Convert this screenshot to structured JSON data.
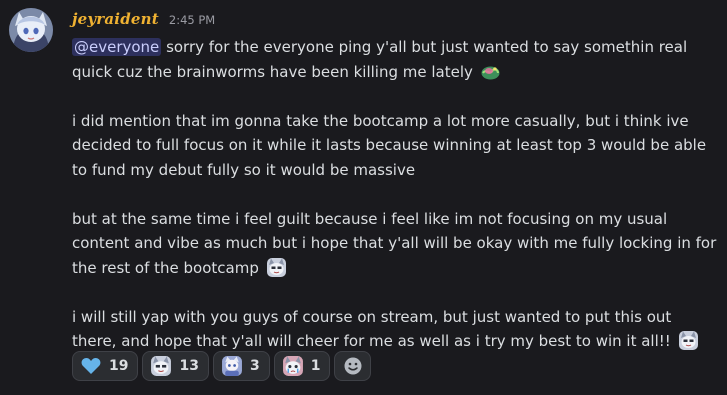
{
  "message": {
    "username": "jeyraident",
    "timestamp": "2:45 PM",
    "mention": "@everyone",
    "paragraphs": [
      " sorry for the everyone ping y'all but just wanted to say somethin real quick cuz the brainworms have been killing me lately",
      "i did mention that im gonna take the bootcamp a lot more casually, but i think ive decided to full focus on it while it lasts because winning at least top 3 would be able to fund my debut fully so it would be massive",
      "but at the same time i feel guilt because i feel like im not focusing on my usual content and vibe as much but i hope that y'all will be okay with me fully locking in for the rest of the bootcamp",
      "i will still yap with you guys of course on stream, but just wanted to put this out there, and hope that y'all will cheer for me as well as i try my best to win it all!!"
    ],
    "inline_emoji": [
      "brainworm-emoji",
      "cat-emote-emoji",
      "cat-emote-emoji"
    ]
  },
  "reactions": [
    {
      "emoji": "blue-heart-icon",
      "count": "19"
    },
    {
      "emoji": "cat-emote-icon",
      "count": "13"
    },
    {
      "emoji": "chibi-emote-icon",
      "count": "3"
    },
    {
      "emoji": "cat-crying-emote-icon",
      "count": "1"
    }
  ],
  "colors": {
    "background": "#1a1a1e",
    "username": "#f0b232",
    "text": "#dbdee1",
    "timestamp": "#9a9ba3",
    "mention_bg": "#3c4270",
    "heart": "#66b4ea"
  },
  "add_reaction_icon": "smiley-add-reaction-icon"
}
